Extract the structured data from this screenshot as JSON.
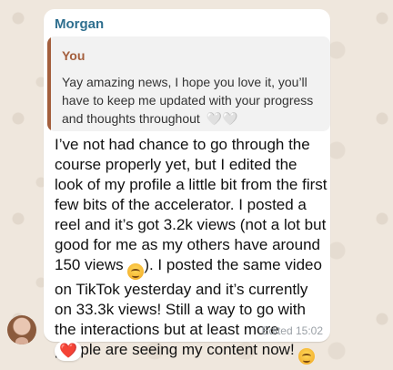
{
  "message": {
    "sender_name": "Morgan",
    "quoted_reply": {
      "author": "You",
      "text": "Yay amazing news, I hope you love it, you’ll have to keep me updated with your progress and thoughts throughout",
      "emoji": "🤍🤍"
    },
    "text_part_1": "I’ve not had chance to go through the course properly yet, but I edited the look of my profile a little bit from the first few bits of the accelerator. I posted a reel and it’s got 3.2k views (not a lot but good for me as my others have around 150 views ",
    "emoji_1": "😆",
    "text_part_2": "). I posted the same video on TikTok yesterday and it’s currently on 33.3k views! Still a way to go with the interactions but at least more people are seeing my content now! ",
    "emoji_2": "🤭",
    "edited_label": "Edited",
    "time": "15:02"
  },
  "reaction": {
    "emoji": "❤️"
  },
  "icons": {
    "avatar": "user-avatar",
    "reaction": "heart-icon"
  }
}
